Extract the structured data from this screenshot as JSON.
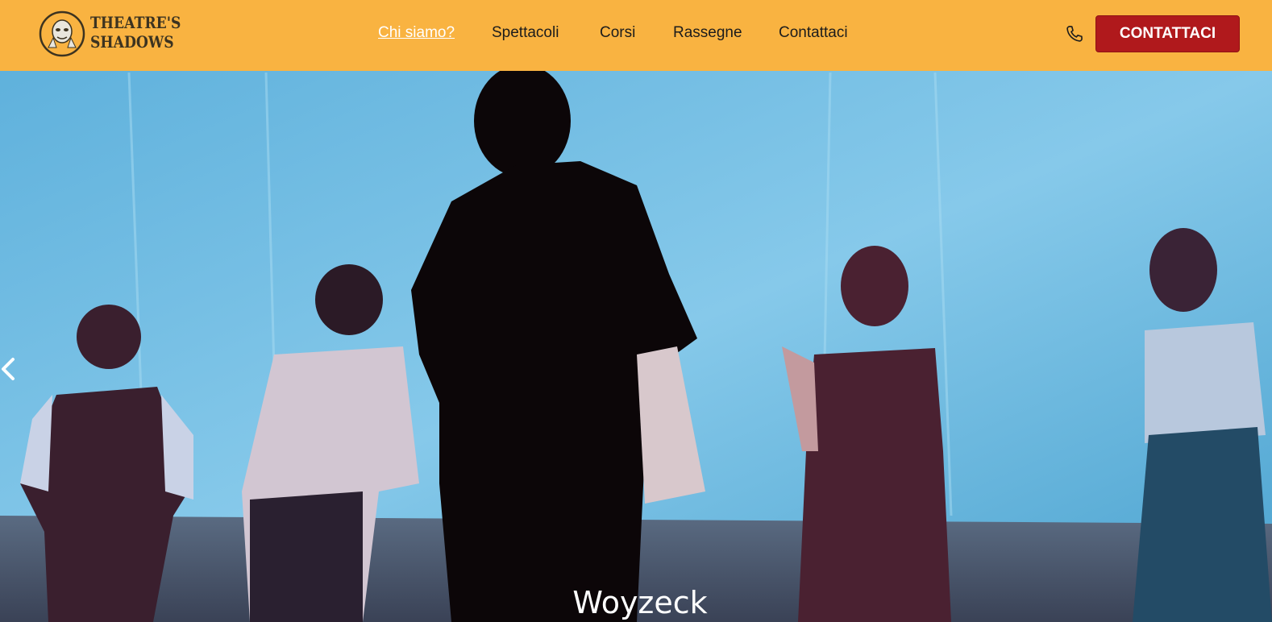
{
  "brand": {
    "line1": "THEATRE'S",
    "line2": "SHADOWS",
    "text_color": "#3c3320"
  },
  "nav": {
    "items": [
      {
        "label": "Chi siamo?",
        "active": true
      },
      {
        "label": "Spettacoli",
        "active": false
      },
      {
        "label": "Corsi",
        "active": false
      },
      {
        "label": "Rassegne",
        "active": false
      },
      {
        "label": "Contattaci",
        "active": false
      }
    ]
  },
  "header": {
    "phone_icon": "phone-icon",
    "cta_label": "CONTATTACI",
    "background": "#f9b341",
    "cta_color": "#b0191c"
  },
  "hero": {
    "caption": "Woyzeck",
    "prev_icon": "chevron-left-icon"
  }
}
